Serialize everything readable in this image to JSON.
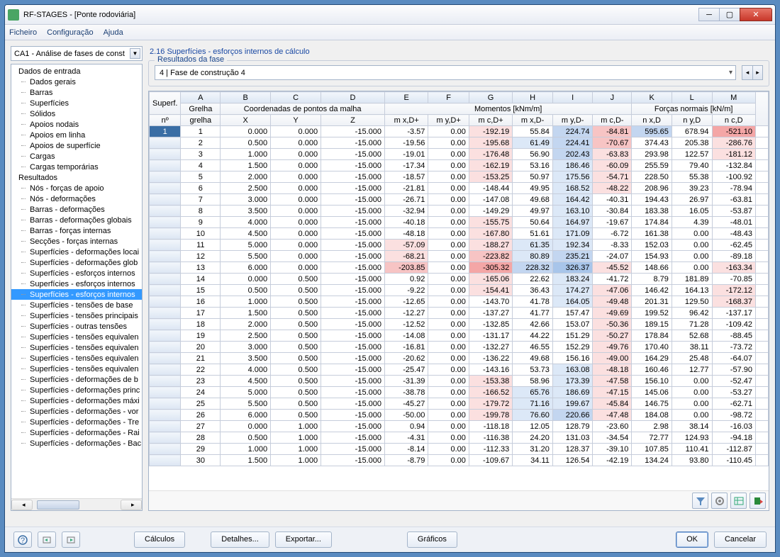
{
  "window": {
    "title": "RF-STAGES - [Ponte rodoviária]"
  },
  "menu": [
    "Ficheiro",
    "Configuração",
    "Ajuda"
  ],
  "combo": "CA1 - Análise de fases de const",
  "tree_group1": "Dados de entrada",
  "tree_items1": [
    "Dados gerais",
    "Barras",
    "Superfícies",
    "Sólidos",
    "Apoios nodais",
    "Apoios em linha",
    "Apoios de superfície",
    "Cargas",
    "Cargas temporárias"
  ],
  "tree_group2": "Resultados",
  "tree_items2": [
    "Nós - forças de apoio",
    "Nós - deformações",
    "Barras - deformações",
    "Barras - deformações globais",
    "Barras - forças internas",
    "Secções - forças internas",
    "Superfícies - deformações locai",
    "Superfícies - deformações glob",
    "Superfícies - esforços internos",
    "Superfícies - esforços internos",
    "Superfícies - esforços internos",
    "Superfícies - tensões de base",
    "Superfícies - tensões principais",
    "Superfícies - outras tensões",
    "Superfícies - tensões equivalen",
    "Superfícies - tensões equivalen",
    "Superfícies - tensões equivalen",
    "Superfícies - tensões equivalen",
    "Superfícies - deformações de b",
    "Superfícies - deformações princ",
    "Superfícies - deformações máxi",
    "Superfícies - deformações - vor",
    "Superfícies - deformações - Tre",
    "Superfícies - deformações - Rai",
    "Superfícies - deformações - Bac"
  ],
  "tree_selected_index": 10,
  "panel_title": "2.16 Superfícies - esforços internos de cálculo",
  "fieldset_legend": "Resultados da fase",
  "phase_label": "4  |  Fase de construção 4",
  "col_letters": [
    "A",
    "B",
    "C",
    "D",
    "E",
    "F",
    "G",
    "H",
    "I",
    "J",
    "K",
    "L",
    "M"
  ],
  "group_headers": {
    "superf": "Superf.",
    "no": "nº",
    "grelha": "Grelha",
    "grelha2": "grelha",
    "coord": "Coordenadas de pontos da malha",
    "mom": "Momentos [kNm/m]",
    "forc": "Forças normais [kN/m]"
  },
  "sub_headers": [
    "X",
    "Y",
    "Z",
    "m x,D+",
    "m y,D+",
    "m c,D+",
    "m x,D-",
    "m y,D-",
    "m c,D-",
    "n x,D",
    "n y,D",
    "n c,D"
  ],
  "rows": [
    [
      "1",
      "1",
      "0.000",
      "0.000",
      "-15.000",
      "-3.57",
      "0.00",
      "-192.19",
      "55.84",
      "224.74",
      "-84.81",
      "595.65",
      "678.94",
      "-521.10"
    ],
    [
      "",
      "2",
      "0.500",
      "0.000",
      "-15.000",
      "-19.56",
      "0.00",
      "-195.68",
      "61.49",
      "224.41",
      "-70.67",
      "374.43",
      "205.38",
      "-286.76"
    ],
    [
      "",
      "3",
      "1.000",
      "0.000",
      "-15.000",
      "-19.01",
      "0.00",
      "-176.48",
      "56.90",
      "202.43",
      "-63.83",
      "293.98",
      "122.57",
      "-181.12"
    ],
    [
      "",
      "4",
      "1.500",
      "0.000",
      "-15.000",
      "-17.34",
      "0.00",
      "-162.19",
      "53.16",
      "186.46",
      "-60.09",
      "255.59",
      "79.40",
      "-132.84"
    ],
    [
      "",
      "5",
      "2.000",
      "0.000",
      "-15.000",
      "-18.57",
      "0.00",
      "-153.25",
      "50.97",
      "175.56",
      "-54.71",
      "228.50",
      "55.38",
      "-100.92"
    ],
    [
      "",
      "6",
      "2.500",
      "0.000",
      "-15.000",
      "-21.81",
      "0.00",
      "-148.44",
      "49.95",
      "168.52",
      "-48.22",
      "208.96",
      "39.23",
      "-78.94"
    ],
    [
      "",
      "7",
      "3.000",
      "0.000",
      "-15.000",
      "-26.71",
      "0.00",
      "-147.08",
      "49.68",
      "164.42",
      "-40.31",
      "194.43",
      "26.97",
      "-63.81"
    ],
    [
      "",
      "8",
      "3.500",
      "0.000",
      "-15.000",
      "-32.94",
      "0.00",
      "-149.29",
      "49.97",
      "163.10",
      "-30.84",
      "183.38",
      "16.05",
      "-53.87"
    ],
    [
      "",
      "9",
      "4.000",
      "0.000",
      "-15.000",
      "-40.18",
      "0.00",
      "-155.75",
      "50.64",
      "164.97",
      "-19.67",
      "174.84",
      "4.39",
      "-48.01"
    ],
    [
      "",
      "10",
      "4.500",
      "0.000",
      "-15.000",
      "-48.18",
      "0.00",
      "-167.80",
      "51.61",
      "171.09",
      "-6.72",
      "161.38",
      "0.00",
      "-48.43"
    ],
    [
      "",
      "11",
      "5.000",
      "0.000",
      "-15.000",
      "-57.09",
      "0.00",
      "-188.27",
      "61.35",
      "192.34",
      "-8.33",
      "152.03",
      "0.00",
      "-62.45"
    ],
    [
      "",
      "12",
      "5.500",
      "0.000",
      "-15.000",
      "-68.21",
      "0.00",
      "-223.82",
      "80.89",
      "235.21",
      "-24.07",
      "154.93",
      "0.00",
      "-89.18"
    ],
    [
      "",
      "13",
      "6.000",
      "0.000",
      "-15.000",
      "-203.85",
      "0.00",
      "-305.32",
      "228.32",
      "326.37",
      "-45.52",
      "148.66",
      "0.00",
      "-163.34"
    ],
    [
      "",
      "14",
      "0.000",
      "0.500",
      "-15.000",
      "0.92",
      "0.00",
      "-165.06",
      "22.62",
      "183.24",
      "-41.72",
      "8.79",
      "181.89",
      "-70.85"
    ],
    [
      "",
      "15",
      "0.500",
      "0.500",
      "-15.000",
      "-9.22",
      "0.00",
      "-154.41",
      "36.43",
      "174.27",
      "-47.06",
      "146.42",
      "164.13",
      "-172.12"
    ],
    [
      "",
      "16",
      "1.000",
      "0.500",
      "-15.000",
      "-12.65",
      "0.00",
      "-143.70",
      "41.78",
      "164.05",
      "-49.48",
      "201.31",
      "129.50",
      "-168.37"
    ],
    [
      "",
      "17",
      "1.500",
      "0.500",
      "-15.000",
      "-12.27",
      "0.00",
      "-137.27",
      "41.77",
      "157.47",
      "-49.69",
      "199.52",
      "96.42",
      "-137.17"
    ],
    [
      "",
      "18",
      "2.000",
      "0.500",
      "-15.000",
      "-12.52",
      "0.00",
      "-132.85",
      "42.66",
      "153.07",
      "-50.36",
      "189.15",
      "71.28",
      "-109.42"
    ],
    [
      "",
      "19",
      "2.500",
      "0.500",
      "-15.000",
      "-14.08",
      "0.00",
      "-131.17",
      "44.22",
      "151.29",
      "-50.27",
      "178.84",
      "52.68",
      "-88.45"
    ],
    [
      "",
      "20",
      "3.000",
      "0.500",
      "-15.000",
      "-16.81",
      "0.00",
      "-132.27",
      "46.55",
      "152.29",
      "-49.76",
      "170.40",
      "38.11",
      "-73.72"
    ],
    [
      "",
      "21",
      "3.500",
      "0.500",
      "-15.000",
      "-20.62",
      "0.00",
      "-136.22",
      "49.68",
      "156.16",
      "-49.00",
      "164.29",
      "25.48",
      "-64.07"
    ],
    [
      "",
      "22",
      "4.000",
      "0.500",
      "-15.000",
      "-25.47",
      "0.00",
      "-143.16",
      "53.73",
      "163.08",
      "-48.18",
      "160.46",
      "12.77",
      "-57.90"
    ],
    [
      "",
      "23",
      "4.500",
      "0.500",
      "-15.000",
      "-31.39",
      "0.00",
      "-153.38",
      "58.96",
      "173.39",
      "-47.58",
      "156.10",
      "0.00",
      "-52.47"
    ],
    [
      "",
      "24",
      "5.000",
      "0.500",
      "-15.000",
      "-38.78",
      "0.00",
      "-166.52",
      "65.76",
      "186.69",
      "-47.15",
      "145.06",
      "0.00",
      "-53.27"
    ],
    [
      "",
      "25",
      "5.500",
      "0.500",
      "-15.000",
      "-45.27",
      "0.00",
      "-179.72",
      "71.16",
      "199.67",
      "-45.84",
      "146.75",
      "0.00",
      "-62.71"
    ],
    [
      "",
      "26",
      "6.000",
      "0.500",
      "-15.000",
      "-50.00",
      "0.00",
      "-199.78",
      "76.60",
      "220.66",
      "-47.48",
      "184.08",
      "0.00",
      "-98.72"
    ],
    [
      "",
      "27",
      "0.000",
      "1.000",
      "-15.000",
      "0.94",
      "0.00",
      "-118.18",
      "12.05",
      "128.79",
      "-23.60",
      "2.98",
      "38.14",
      "-16.03"
    ],
    [
      "",
      "28",
      "0.500",
      "1.000",
      "-15.000",
      "-4.31",
      "0.00",
      "-116.38",
      "24.20",
      "131.03",
      "-34.54",
      "72.77",
      "124.93",
      "-94.18"
    ],
    [
      "",
      "29",
      "1.000",
      "1.000",
      "-15.000",
      "-8.14",
      "0.00",
      "-112.33",
      "31.20",
      "128.37",
      "-39.10",
      "107.85",
      "110.41",
      "-112.87"
    ],
    [
      "",
      "30",
      "1.500",
      "1.000",
      "-15.000",
      "-8.79",
      "0.00",
      "-109.67",
      "34.11",
      "126.54",
      "-42.19",
      "134.24",
      "93.80",
      "-110.45"
    ]
  ],
  "footer": {
    "calc": "Cálculos",
    "det": "Detalhes...",
    "exp": "Exportar...",
    "graf": "Gráficos",
    "ok": "OK",
    "cancel": "Cancelar"
  }
}
